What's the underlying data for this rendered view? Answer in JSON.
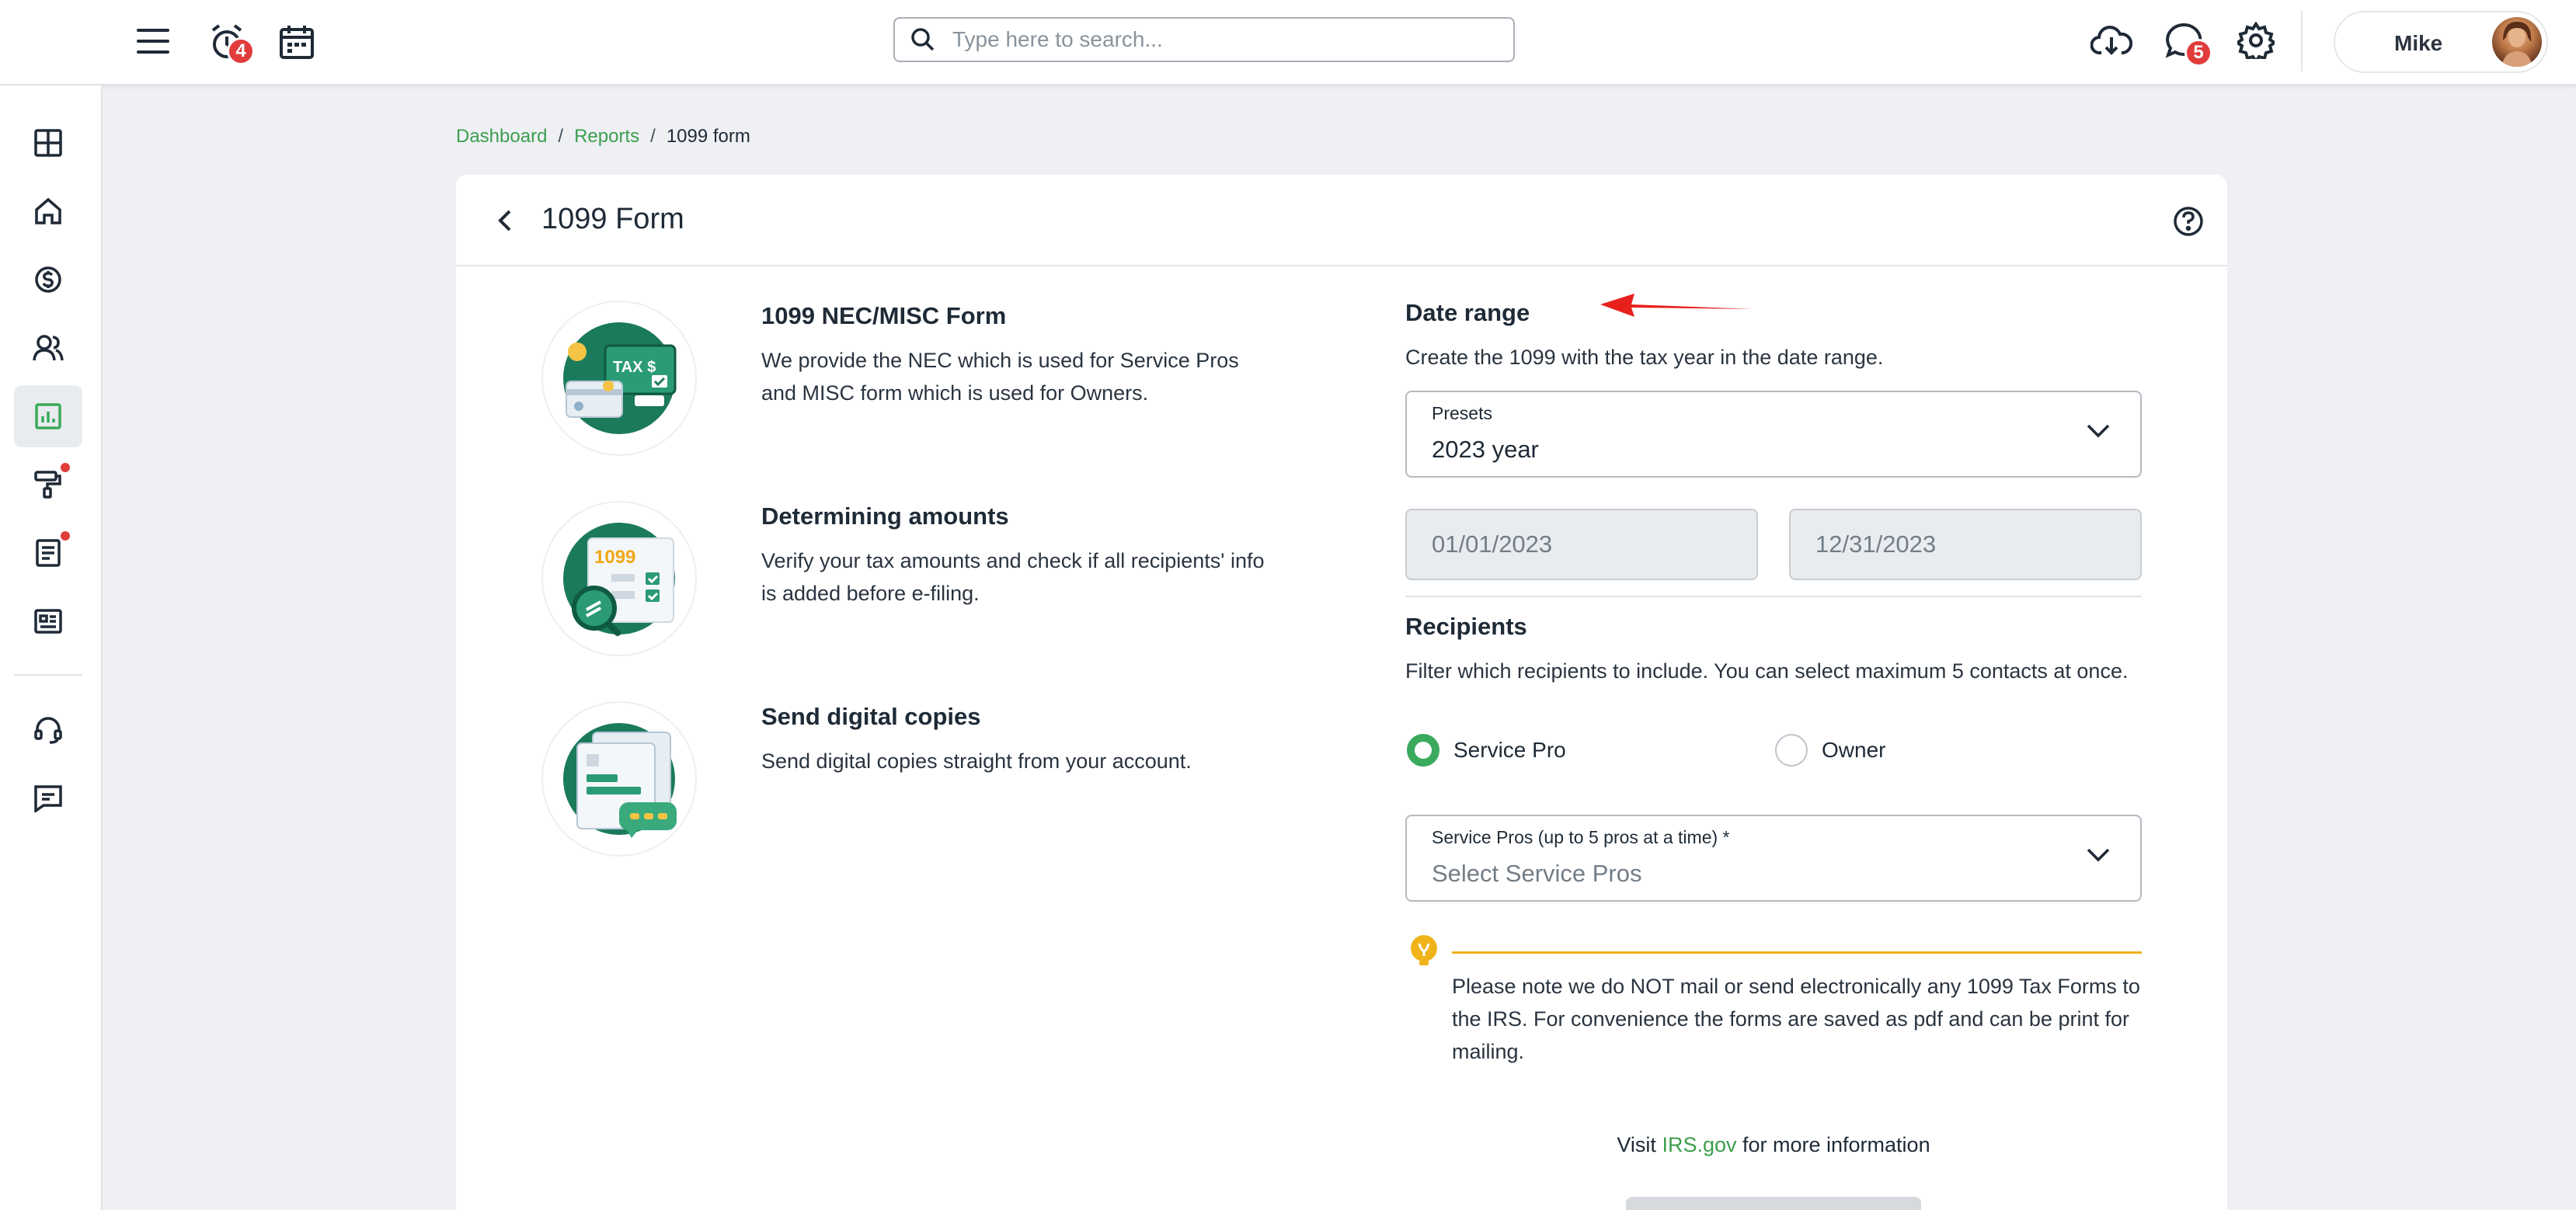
{
  "topbar": {
    "alerts_badge": "4",
    "messages_badge": "5",
    "search_placeholder": "Type here to search...",
    "user_name": "Mike"
  },
  "breadcrumb": {
    "items": [
      "Dashboard",
      "Reports"
    ],
    "separator": "/",
    "current": "1099 form"
  },
  "page": {
    "title": "1099 Form"
  },
  "features": [
    {
      "title": "1099 NEC/MISC Form",
      "text": "We provide the NEC which is used for Service Pros and MISC form which is used for Owners."
    },
    {
      "title": "Determining amounts",
      "text": "Verify your tax amounts and check if all recipients' info is added before e-filing."
    },
    {
      "title": "Send digital copies",
      "text": "Send digital copies straight from your account."
    }
  ],
  "illustrations": {
    "tax_label": "TAX $",
    "form_number": "1099"
  },
  "date_range": {
    "title": "Date range",
    "description": "Create the 1099 with the tax year in the date range.",
    "presets_label": "Presets",
    "presets_value": "2023 year",
    "start_date": "01/01/2023",
    "end_date": "12/31/2023"
  },
  "recipients": {
    "title": "Recipients",
    "description": "Filter which recipients to include. You can select maximum 5 contacts at once.",
    "options": [
      "Service Pro",
      "Owner"
    ],
    "selected": "Service Pro",
    "pros_label": "Service Pros (up to 5 pros at a time) *",
    "pros_placeholder": "Select Service Pros"
  },
  "note": {
    "text": "Please note we do NOT mail or send electronically any 1099 Tax Forms to the IRS. For convenience the forms are saved as pdf and can be print for mailing."
  },
  "visit": {
    "prefix": "Visit",
    "link": "IRS.gov",
    "suffix": "for more information"
  },
  "colors": {
    "accent_green": "#3aaa5c",
    "link_green": "#3d9e4e",
    "badge_red": "#e03c3c",
    "note_yellow": "#f0b31a",
    "arrow_red": "#e8201c"
  }
}
